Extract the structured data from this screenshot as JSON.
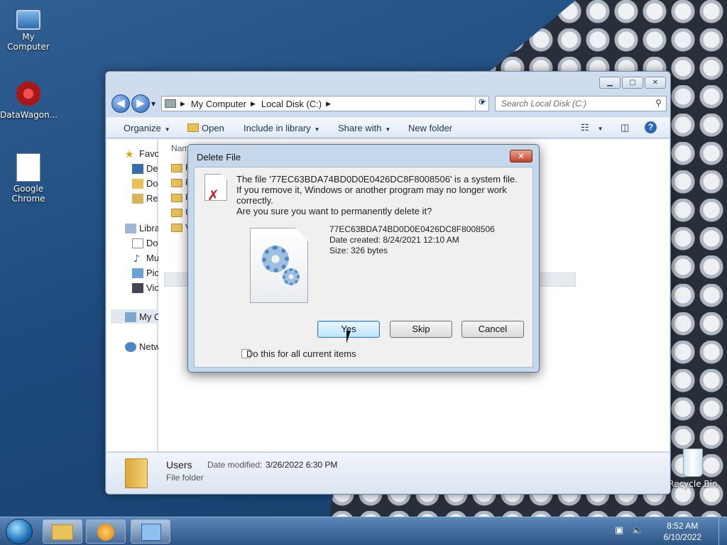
{
  "desktop": {
    "icons": [
      {
        "label": "My Computer"
      },
      {
        "label": "DataWagon..."
      },
      {
        "label": "Google Chrome"
      },
      {
        "label": "Recycle Bin"
      }
    ]
  },
  "explorer": {
    "address": {
      "crumbs": [
        "My Computer",
        "Local Disk (C:)"
      ]
    },
    "search": {
      "placeholder": "Search Local Disk (C:)"
    },
    "toolbar": {
      "organize": "Organize",
      "open": "Open",
      "include": "Include in library",
      "share": "Share with",
      "new_folder": "New folder"
    },
    "nav_pane": {
      "items": [
        "Favo",
        "De",
        "Do",
        "Re",
        "Libra",
        "Do",
        "Mu",
        "Pic",
        "Vic",
        "My C",
        "Netw"
      ]
    },
    "content": {
      "column_name": "Nam",
      "folder_initials": [
        "P",
        "P",
        "P",
        "U",
        "V"
      ]
    },
    "details": {
      "name": "Users",
      "type": "File folder",
      "date_label": "Date modified:",
      "date_value": "3/26/2022 6:30 PM"
    }
  },
  "dialog": {
    "title": "Delete File",
    "message": "The file '77EC63BDA74BD0D0E0426DC8F8008506' is a system file. If you remove it, Windows or another program may no longer work correctly.",
    "question": "Are you sure you want to permanently delete it?",
    "file_name": "77EC63BDA74BD0D0E0426DC8F8008506",
    "date_created": "Date created: 8/24/2021 12:10 AM",
    "size": "Size: 326 bytes",
    "buttons": {
      "yes": "Yes",
      "skip": "Skip",
      "cancel": "Cancel"
    },
    "checkbox_label": "Do this for all current items"
  },
  "taskbar": {
    "time": "8:52 AM",
    "date": "6/10/2022"
  }
}
